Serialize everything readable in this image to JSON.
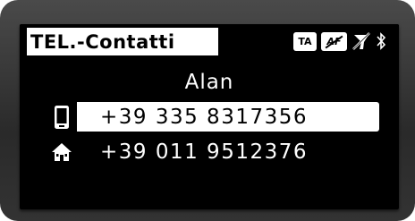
{
  "header": {
    "title": "TEL.-Contatti",
    "badges": {
      "ta_label": "TA",
      "af_label": "AF"
    },
    "icons": [
      "no-signal-icon",
      "bluetooth-icon"
    ]
  },
  "contact": {
    "name": "Alan"
  },
  "numbers": [
    {
      "type_icon": "mobile-phone-icon",
      "number": "+39 335 8317356",
      "selected": true
    },
    {
      "type_icon": "home-icon",
      "number": "+39 011 9512376",
      "selected": false
    }
  ],
  "colors": {
    "screen_bg": "#000000",
    "highlight_bg": "#ffffff",
    "text_primary": "#ffffff"
  }
}
